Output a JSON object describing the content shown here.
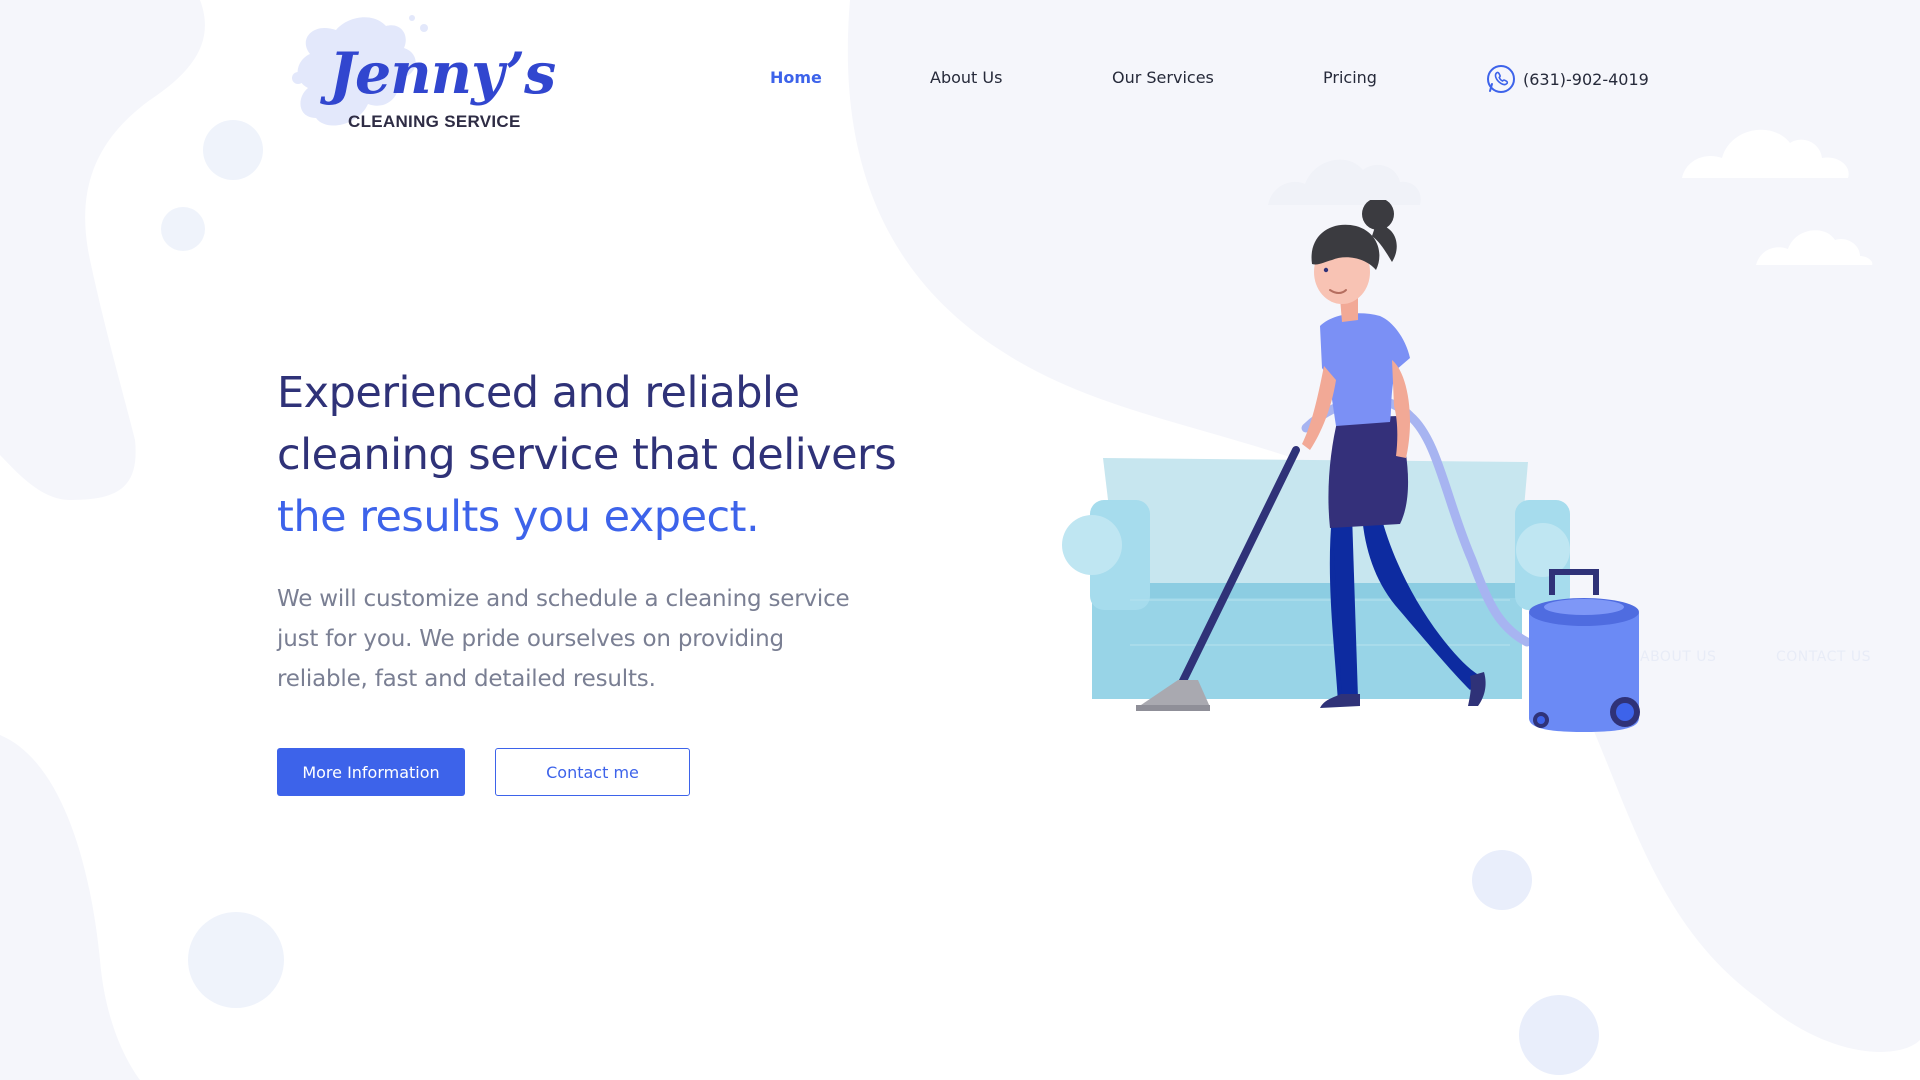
{
  "brand": {
    "name": "Jenny’s",
    "tagline": "CLEANING SERVICE"
  },
  "nav": {
    "home": "Home",
    "about": "About Us",
    "services": "Our Services",
    "pricing": "Pricing",
    "phone": "(631)-902-4019",
    "phone_icon": "phone-icon"
  },
  "hero": {
    "headline_line1": "Experienced and reliable",
    "headline_line2": "cleaning service that delivers",
    "headline_line3": "the results you expect.",
    "desc_line1": "We will customize and schedule a cleaning service",
    "desc_line2": "just for you. We pride ourselves on providing",
    "desc_line3": "reliable, fast and detailed results.",
    "primary_button": "More Information",
    "secondary_button": "Contact me"
  },
  "colors": {
    "accent": "#3d63ea",
    "heading": "#2f3278",
    "body_text": "#7a7f93",
    "background_shape": "#f5f6fb"
  }
}
